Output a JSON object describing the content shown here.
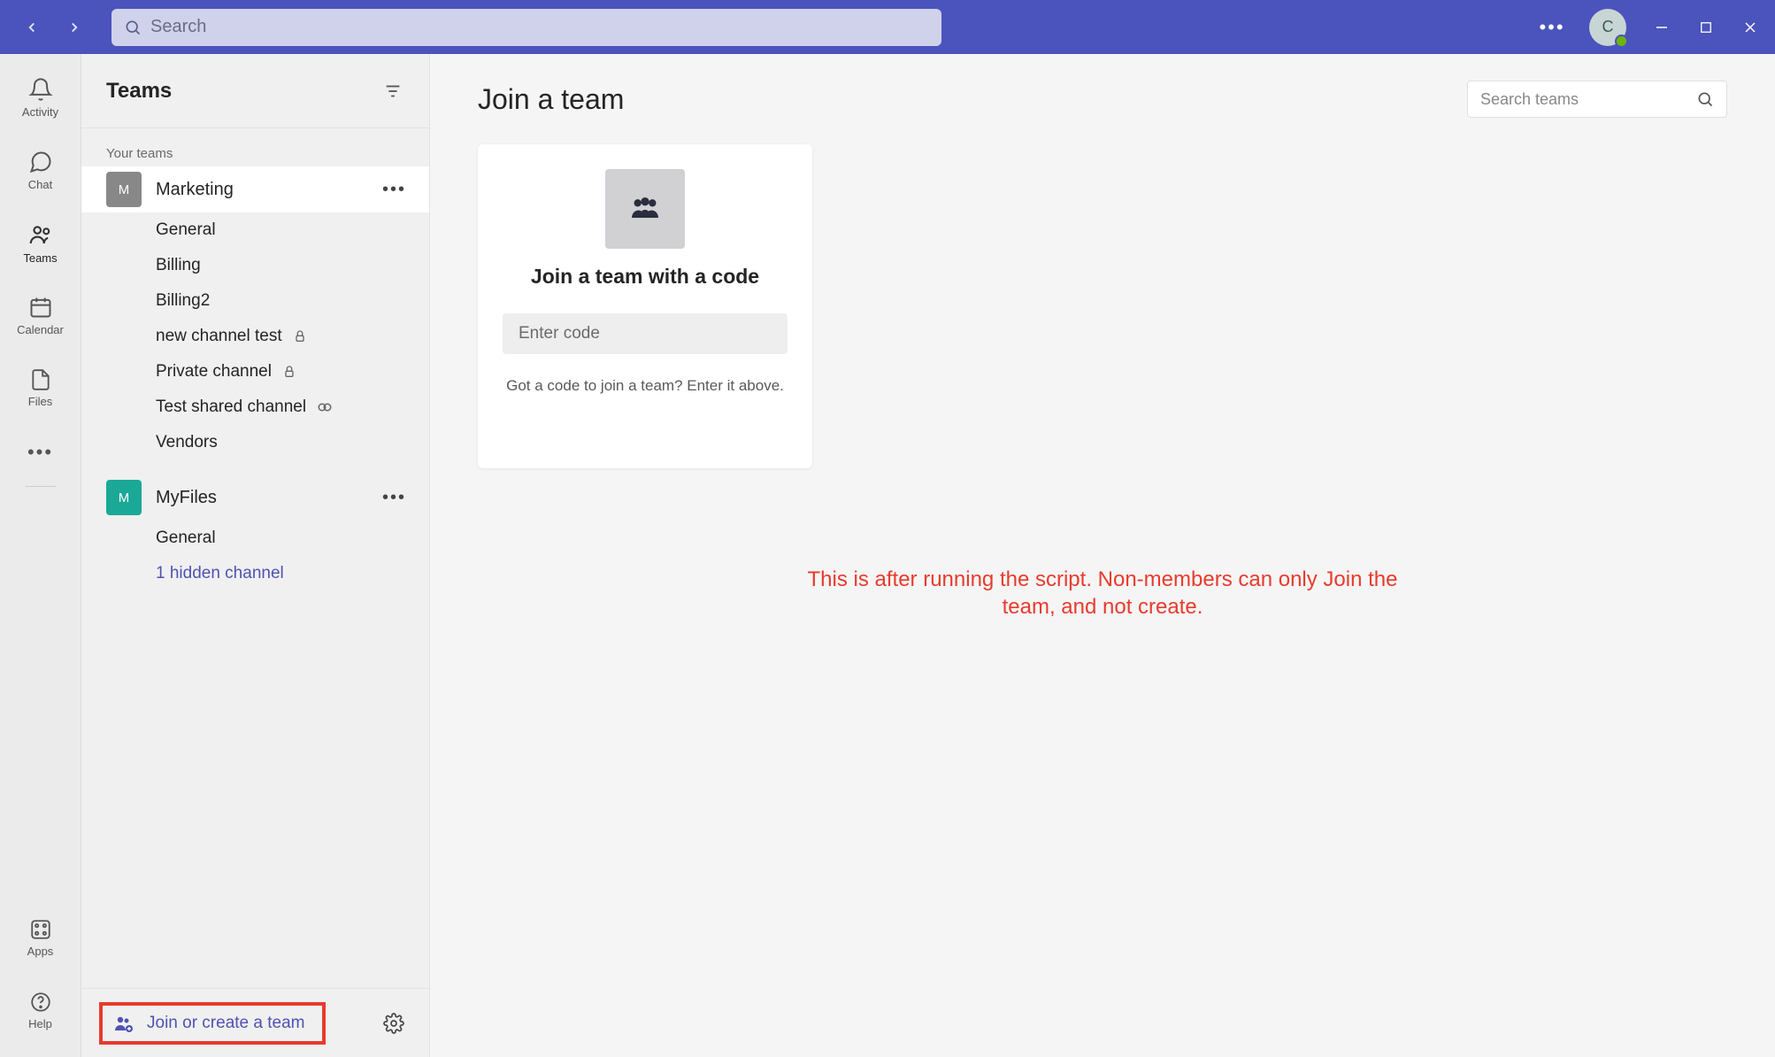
{
  "titlebar": {
    "search_placeholder": "Search",
    "avatar_initial": "C"
  },
  "rail": {
    "items": [
      {
        "label": "Activity"
      },
      {
        "label": "Chat"
      },
      {
        "label": "Teams"
      },
      {
        "label": "Calendar"
      },
      {
        "label": "Files"
      }
    ],
    "bottom": [
      {
        "label": "Apps"
      },
      {
        "label": "Help"
      }
    ]
  },
  "panel": {
    "title": "Teams",
    "section_label": "Your teams",
    "teams": [
      {
        "name": "Marketing",
        "avatar_letter": "M",
        "avatar_color": "#888888",
        "channels": [
          {
            "name": "General",
            "icon": null
          },
          {
            "name": "Billing",
            "icon": null
          },
          {
            "name": "Billing2",
            "icon": null
          },
          {
            "name": "new channel test",
            "icon": "lock"
          },
          {
            "name": "Private channel",
            "icon": "lock"
          },
          {
            "name": "Test shared channel",
            "icon": "share"
          },
          {
            "name": "Vendors",
            "icon": null
          }
        ]
      },
      {
        "name": "MyFiles",
        "avatar_letter": "M",
        "avatar_color": "#1aa897",
        "channels": [
          {
            "name": "General",
            "icon": null
          }
        ],
        "hidden_link": "1 hidden channel"
      }
    ],
    "join_create": "Join or create a team"
  },
  "main": {
    "title": "Join a team",
    "search_placeholder": "Search teams",
    "card": {
      "title": "Join a team with a code",
      "code_placeholder": "Enter code",
      "hint": "Got a code to join a team? Enter it above."
    },
    "annotation": "This is after running the script. Non-members can only Join the team, and not create."
  }
}
